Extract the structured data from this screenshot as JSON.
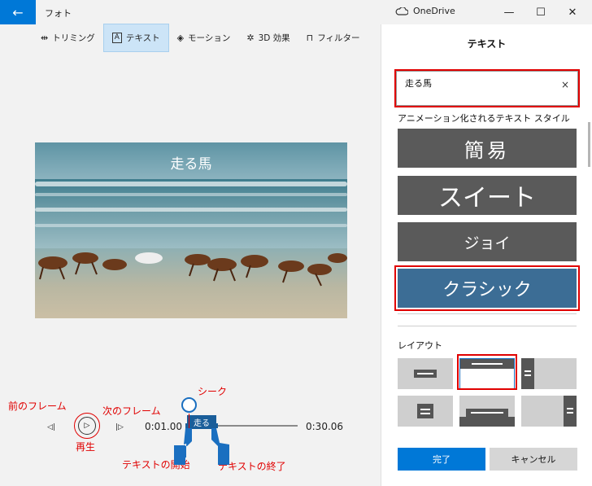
{
  "titlebar": {
    "back_icon": "←",
    "app_title": "フォト",
    "onedrive_label": "OneDrive",
    "minimize": "—",
    "maximize": "☐",
    "close": "✕"
  },
  "toolbar": {
    "items": [
      {
        "icon": "trim-icon",
        "glyph": "⇹",
        "label": "トリミング"
      },
      {
        "icon": "text-icon",
        "glyph": "A⃞",
        "label": "テキスト"
      },
      {
        "icon": "motion-icon",
        "glyph": "◈",
        "label": "モーション"
      },
      {
        "icon": "3d-effects-icon",
        "glyph": "✲",
        "label": "3D 効果"
      },
      {
        "icon": "filter-icon",
        "glyph": "⊓",
        "label": "フィルター"
      }
    ]
  },
  "video": {
    "overlay_text": "走る馬"
  },
  "playback": {
    "prev_frame_icon": "◁|",
    "play_icon": "▷",
    "next_frame_icon": "|▷",
    "current_time": "0:01.00",
    "end_time": "0:30.06",
    "text_chip": "走る"
  },
  "annotations": {
    "seek": "シーク",
    "prev_frame": "前のフレーム",
    "next_frame": "次のフレーム",
    "play": "再生",
    "text_start": "テキストの開始",
    "text_end": "テキストの終了",
    "color": "#e00000"
  },
  "panel": {
    "title": "テキスト",
    "text_value": "走る馬",
    "clear_icon": "×",
    "styles_heading": "アニメーション化されるテキスト スタイル",
    "styles": [
      "簡易",
      "スイート",
      "ジョイ",
      "クラシック"
    ],
    "selected_style": "クラシック",
    "layout_heading": "レイアウト",
    "done_label": "完了",
    "cancel_label": "キャンセル"
  },
  "colors": {
    "accent": "#0078d7",
    "selected_style": "#3c6d95",
    "style_button": "#5a5a5a"
  }
}
